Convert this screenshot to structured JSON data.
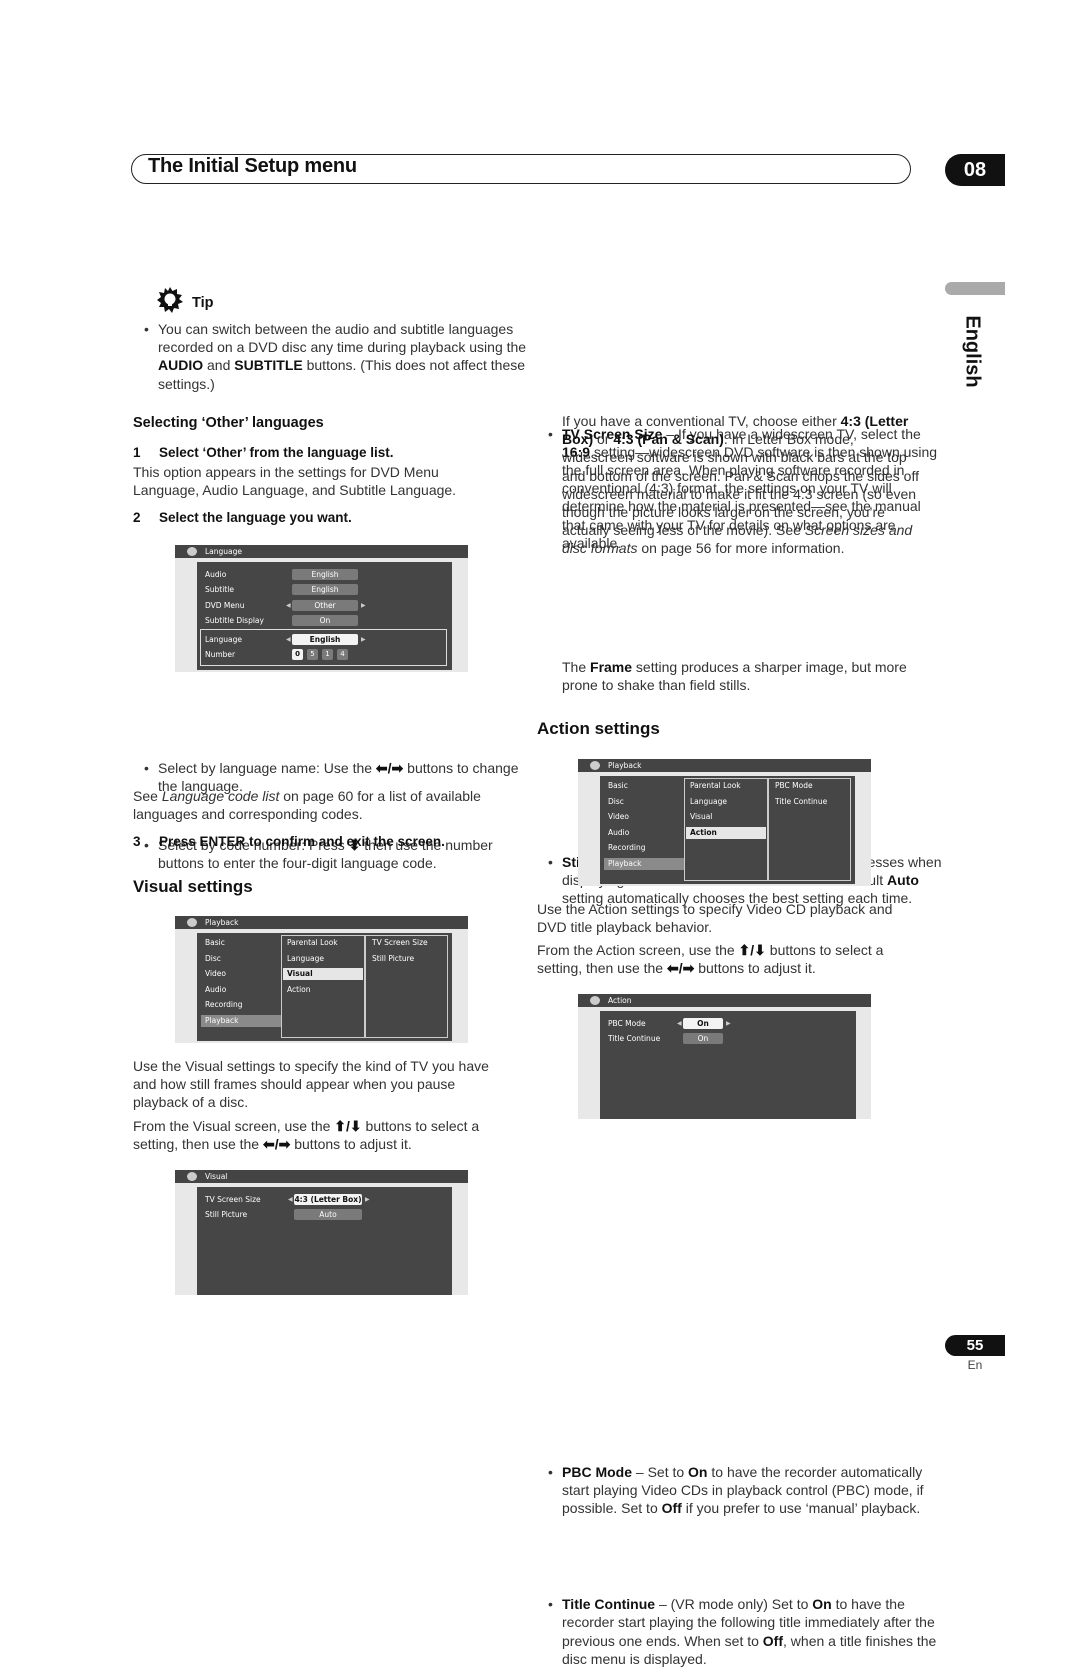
{
  "header": {
    "title": "The Initial Setup menu",
    "chapter": "08"
  },
  "side_tab": {
    "language": "English"
  },
  "footer": {
    "page_number": "55",
    "lang_code": "En"
  },
  "tip": {
    "label": "Tip",
    "bullet_pre": "You can switch between the audio and subtitle languages recorded on a DVD disc any time during playback using the ",
    "bold1": "AUDIO",
    "mid": " and ",
    "bold2": "SUBTITLE",
    "post": " buttons. (This does not affect these settings.)"
  },
  "other_lang": {
    "heading": "Selecting ‘Other’ languages",
    "step1_num": "1",
    "step1": "Select ‘Other’ from the language list.",
    "step1_desc": "This option appears in the settings for DVD Menu Language, Audio Language, and Subtitle Language.",
    "step2_num": "2",
    "step2": "Select the language you want.",
    "bullet1_pre": "Select by language name: Use the ",
    "bullet1_arrows": "⬅/➡",
    "bullet1_post": " buttons to change the language.",
    "bullet2_pre": "Select by code number: Press ",
    "bullet2_arrow": "⬇",
    "bullet2_post": " then use the number buttons to enter the four-digit language code.",
    "see_pre": "See ",
    "see_italic": "Language code list",
    "see_post": " on page 60 for a list of available languages and corresponding codes.",
    "step3_num": "3",
    "step3": "Press ENTER to confirm and exit the screen."
  },
  "osd_language": {
    "title": "Language",
    "rows": [
      {
        "label": "Audio",
        "value": "English"
      },
      {
        "label": "Subtitle",
        "value": "English"
      },
      {
        "label": "DVD Menu",
        "value": "Other"
      },
      {
        "label": "Subtitle Display",
        "value": "On"
      },
      {
        "label": "Language",
        "value": "English"
      },
      {
        "label": "Number",
        "digits": [
          "0",
          "5",
          "1",
          "4"
        ]
      }
    ]
  },
  "visual": {
    "heading": "Visual settings",
    "desc1": "Use the Visual settings to specify the kind of TV you have and how still frames should appear when you pause playback of a disc.",
    "desc2_pre": "From the Visual screen, use the ",
    "updown": "⬆/⬇",
    "desc2_mid": " buttons to select a setting, then use the ",
    "leftright": "⬅/➡",
    "desc2_post": " buttons to adjust it."
  },
  "osd_playback_visual": {
    "title": "Playback",
    "col1": [
      "Basic",
      "Disc",
      "Video",
      "Audio",
      "Recording",
      "Playback"
    ],
    "col2": [
      "Parental Look",
      "Language",
      "Visual",
      "Action"
    ],
    "col3": [
      "TV Screen Size",
      "Still Picture"
    ]
  },
  "osd_visual": {
    "title": "Visual",
    "rows": [
      {
        "label": "TV Screen Size",
        "value": "4:3 (Letter Box)"
      },
      {
        "label": "Still Picture",
        "value": "Auto"
      }
    ]
  },
  "tv_screen": {
    "b_label": "TV Screen Size",
    "t1": " – If you have a widescreen TV, select the ",
    "b169": "16:9",
    "t2": " setting—widescreen DVD software is then shown using the full screen area. When playing software recorded in conventional (4:3) format, the settings on your TV will determine how the material is presented—see the manual that came with your TV for details on what options are available.",
    "p2_pre": "If you have a conventional TV, choose either ",
    "p2_b1": "4:3 (Letter Box)",
    "p2_or": " or ",
    "p2_b2": "4:3 (Pan & Scan)",
    "p2_mid": ". In Letter Box mode, widescreen software is shown with black bars at the top and bottom of the screen. Pan & Scan chops the sides off widescreen material to make it fit the 4:3 screen (so even though the picture looks larger on the screen, you’re actually seeing less of the movie). See ",
    "p2_italic": "Screen sizes and disc formats",
    "p2_post": " on page 56 for more information."
  },
  "still_picture": {
    "b_label": "Still Picture",
    "t1": " – The recorder uses one of two processes when displaying a still frame from a DVD disc. The default ",
    "b_auto": "Auto",
    "t2": " setting automatically chooses the best setting each time.",
    "p2_pre": "The ",
    "p2_b": "Frame",
    "p2_post": " setting produces a sharper image, but more prone to shake than field stills."
  },
  "action": {
    "heading": "Action settings",
    "desc1": "Use the Action settings to specify Video CD playback and DVD title playback behavior.",
    "desc2_pre": "From the Action screen, use the ",
    "updown": "⬆/⬇",
    "desc2_mid": " buttons to select a setting, then use the ",
    "leftright": "⬅/➡",
    "desc2_post": " buttons to adjust it."
  },
  "osd_playback_action": {
    "title": "Playback",
    "col1": [
      "Basic",
      "Disc",
      "Video",
      "Audio",
      "Recording",
      "Playback"
    ],
    "col2": [
      "Parental Look",
      "Language",
      "Visual",
      "Action"
    ],
    "col3": [
      "PBC Mode",
      "Title Continue"
    ]
  },
  "osd_action": {
    "title": "Action",
    "rows": [
      {
        "label": "PBC Mode",
        "value": "On"
      },
      {
        "label": "Title Continue",
        "value": "On"
      }
    ]
  },
  "pbc": {
    "b_label": "PBC Mode",
    "t1": " – Set to ",
    "b_on": "On",
    "t2": " to have the recorder automatically start playing Video CDs in playback control (PBC) mode, if possible. Set to ",
    "b_off": "Off",
    "t3": " if you prefer to use ‘manual’ playback."
  },
  "title_continue": {
    "b_label": "Title Continue",
    "t1": " – (VR mode only) Set to ",
    "b_on": "On",
    "t2": " to have the recorder start playing the following title immediately after the previous one ends. When set to ",
    "b_off": "Off",
    "t3": ", when a title finishes the disc menu is displayed."
  }
}
